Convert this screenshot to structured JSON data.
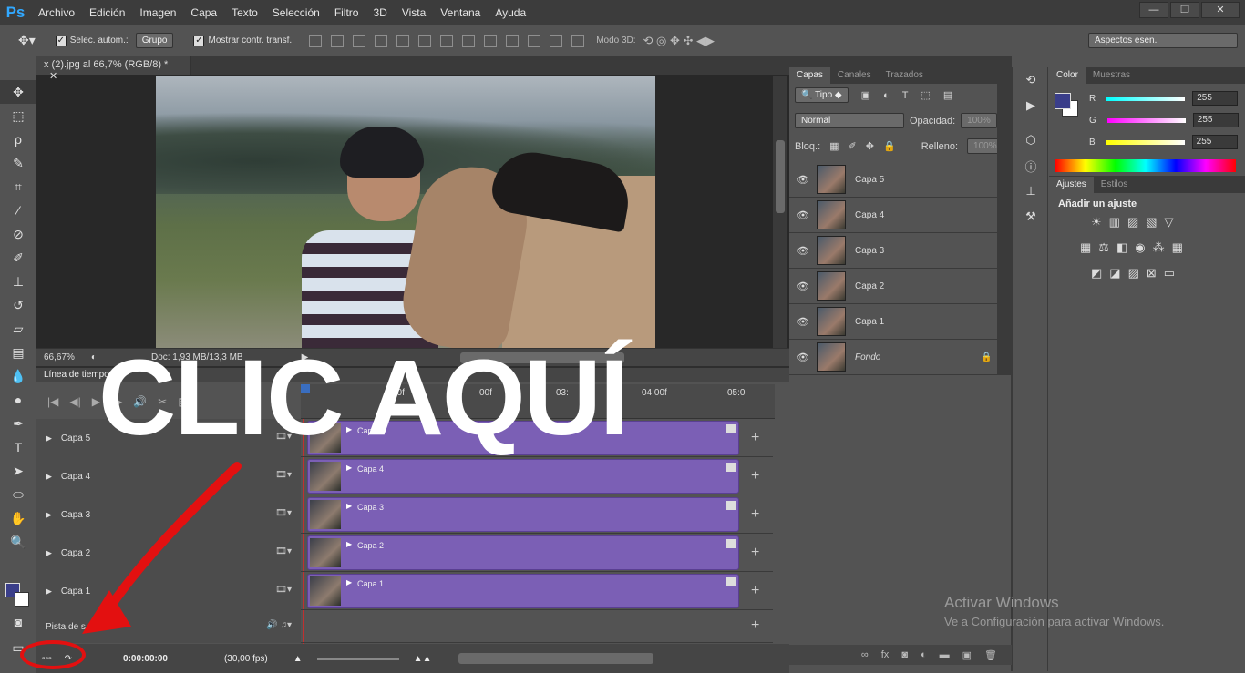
{
  "app": {
    "logo": "Ps",
    "menu": [
      "Archivo",
      "Edición",
      "Imagen",
      "Capa",
      "Texto",
      "Selección",
      "Filtro",
      "3D",
      "Vista",
      "Ventana",
      "Ayuda"
    ]
  },
  "window_controls": {
    "minimize": "—",
    "restore": "❐",
    "close": "✕"
  },
  "options": {
    "auto_select_label": "Selec. autom.:",
    "auto_select_value": "Grupo",
    "show_transform": "Mostrar contr. transf.",
    "mode3d_label": "Modo 3D:",
    "workspace": "Aspectos esen."
  },
  "document": {
    "tab_title": "x (2).jpg al 66,7% (RGB/8) *",
    "zoom": "66,67%",
    "doc_size": "Doc: 1,93 MB/13,3 MB"
  },
  "timeline": {
    "title": "Línea de tiempo",
    "ruler": [
      "00f",
      "00f",
      "03:",
      "04:00f",
      "05:0"
    ],
    "tracks": [
      {
        "name": "Capa 5",
        "clip": "Capa 5"
      },
      {
        "name": "Capa 4",
        "clip": "Capa 4"
      },
      {
        "name": "Capa 3",
        "clip": "Capa 3"
      },
      {
        "name": "Capa 2",
        "clip": "Capa 2"
      },
      {
        "name": "Capa 1",
        "clip": "Capa 1"
      }
    ],
    "audio_track": "Pista de s",
    "time": "0:00:00:00",
    "fps": "(30,00 fps)"
  },
  "overlay": {
    "big_text": "CLIC AQUÍ"
  },
  "layers": {
    "tabs": [
      "Capas",
      "Canales",
      "Trazados"
    ],
    "filter": "Tipo",
    "blend": "Normal",
    "opacity_label": "Opacidad:",
    "opacity_value": "100%",
    "lock_label": "Bloq.:",
    "fill_label": "Relleno:",
    "fill_value": "100%",
    "items": [
      "Capa 5",
      "Capa 4",
      "Capa 3",
      "Capa 2",
      "Capa 1",
      "Fondo"
    ]
  },
  "color": {
    "tabs": [
      "Color",
      "Muestras"
    ],
    "r_label": "R",
    "g_label": "G",
    "b_label": "B",
    "r": "255",
    "g": "255",
    "b": "255"
  },
  "adjustments": {
    "tabs": [
      "Ajustes",
      "Estilos"
    ],
    "add_label": "Añadir un ajuste"
  },
  "watermark": {
    "line1": "Activar Windows",
    "line2": "Ve a Configuración para activar Windows."
  }
}
